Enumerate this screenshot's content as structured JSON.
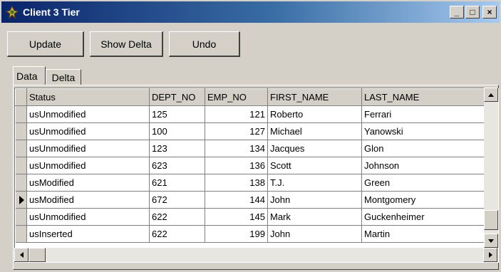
{
  "window": {
    "title": "Client 3 Tier"
  },
  "caption_buttons": {
    "minimize": "_",
    "maximize": "□",
    "close": "×"
  },
  "toolbar": {
    "update_label": "Update",
    "show_delta_label": "Show Delta",
    "undo_label": "Undo"
  },
  "tabs": [
    {
      "label": "Data",
      "active": true
    },
    {
      "label": "Delta",
      "active": false
    }
  ],
  "grid": {
    "columns": [
      "Status",
      "DEPT_NO",
      "EMP_NO",
      "FIRST_NAME",
      "LAST_NAME"
    ],
    "current_row": 5,
    "rows": [
      {
        "status": "usUnmodified",
        "dept_no": "125",
        "emp_no": "121",
        "first_name": "Roberto",
        "last_name": "Ferrari"
      },
      {
        "status": "usUnmodified",
        "dept_no": "100",
        "emp_no": "127",
        "first_name": "Michael",
        "last_name": "Yanowski"
      },
      {
        "status": "usUnmodified",
        "dept_no": "123",
        "emp_no": "134",
        "first_name": "Jacques",
        "last_name": "Glon"
      },
      {
        "status": "usUnmodified",
        "dept_no": "623",
        "emp_no": "136",
        "first_name": "Scott",
        "last_name": "Johnson"
      },
      {
        "status": "usModified",
        "dept_no": "621",
        "emp_no": "138",
        "first_name": "T.J.",
        "last_name": "Green"
      },
      {
        "status": "usModified",
        "dept_no": "672",
        "emp_no": "144",
        "first_name": "John",
        "last_name": "Montgomery"
      },
      {
        "status": "usUnmodified",
        "dept_no": "622",
        "emp_no": "145",
        "first_name": "Mark",
        "last_name": "Guckenheimer"
      },
      {
        "status": "usInserted",
        "dept_no": "622",
        "emp_no": "199",
        "first_name": "John",
        "last_name": "Martin"
      }
    ]
  },
  "colors": {
    "title_bar_start": "#0a246a",
    "title_bar_end": "#a6caf0",
    "face": "#d4d0c8"
  }
}
